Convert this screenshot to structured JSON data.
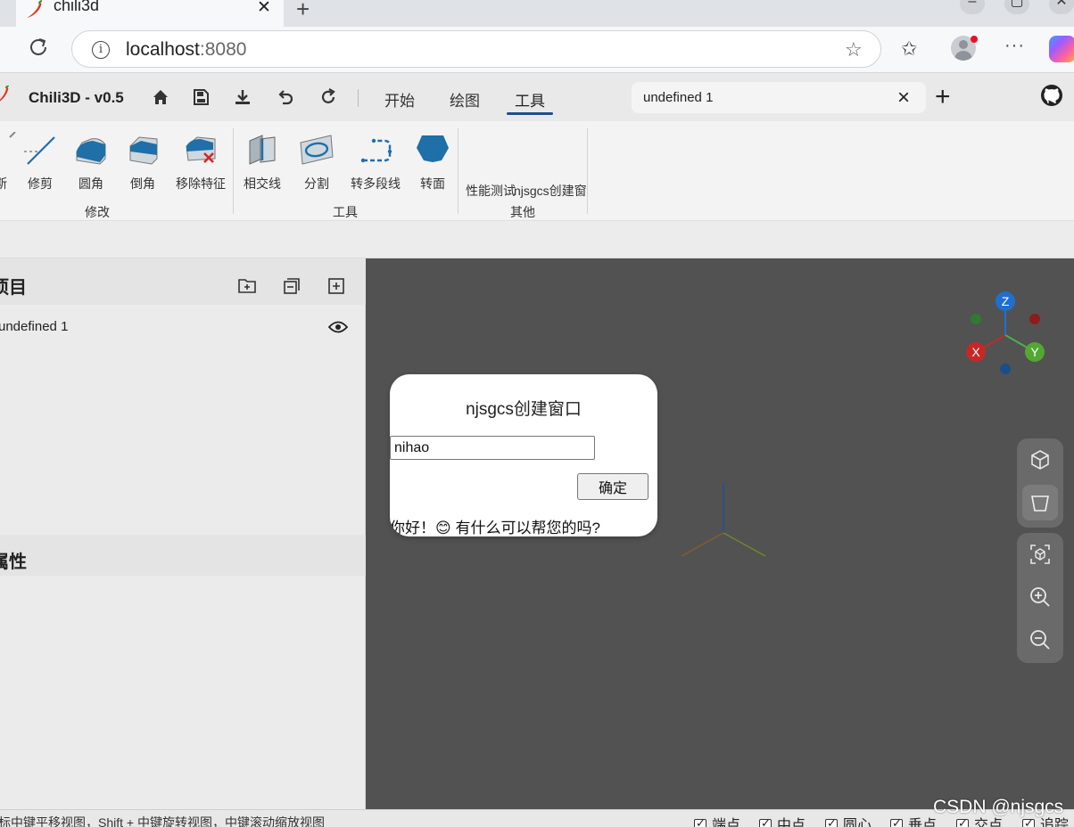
{
  "browser": {
    "tab_title": "chili3d",
    "url_host": "localhost",
    "url_port": ":8080"
  },
  "app": {
    "title": "Chili3D - v0.5",
    "menu_tabs": [
      "开始",
      "绘图",
      "工具"
    ],
    "active_menu_tab": "工具",
    "document_tab": "undefined 1"
  },
  "ribbon": {
    "partial_label": "斯",
    "modify_buttons": [
      "修剪",
      "圆角",
      "倒角",
      "移除特征"
    ],
    "tool_buttons": [
      "相交线",
      "分割",
      "转多段线",
      "转面"
    ],
    "other_buttons": [
      "性能测试",
      "njsgcs创建窗"
    ],
    "groups": [
      "修改",
      "工具",
      "其他"
    ],
    "accent_color": "#1f6fa8"
  },
  "sidebar": {
    "project_title": "项目",
    "tree_items": [
      "undefined 1"
    ],
    "properties_title": "属性"
  },
  "viewport": {
    "axes": [
      "Z",
      "X",
      "Y"
    ],
    "background": "#525252"
  },
  "dialog": {
    "title": "njsgcs创建窗口",
    "input_value": "nihao",
    "confirm_label": "确定",
    "reply": "你好！😊 有什么可以帮您的吗?"
  },
  "statusbar": {
    "hint": "标中键平移视图，Shift + 中键旋转视图，中键滚动缩放视图",
    "snaps": [
      "端点",
      "中点",
      "圆心",
      "垂点",
      "交点",
      "追踪"
    ]
  },
  "watermark": "CSDN @njsgcs"
}
